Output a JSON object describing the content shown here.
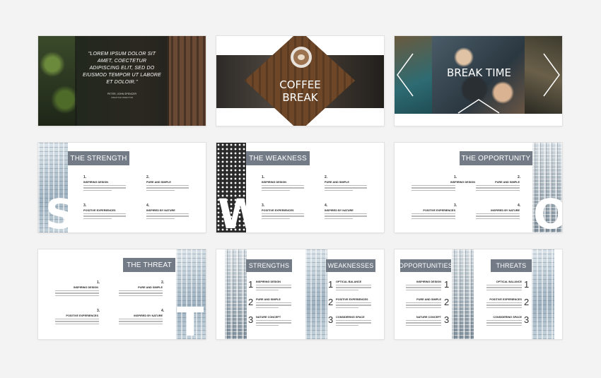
{
  "slide1": {
    "quote": "\"LOREM IPSUM DOLOR SIT AMET, COECTETUR ADIPISCING ELIT, SED DO EIUSMOD TEMPOR UT LABORE ET DOLOIR.\"",
    "author": "PETER, JOHN SPENCER",
    "role": "CREATIVE DIRECTOR"
  },
  "slide2": {
    "title_line1": "COFFEE",
    "title_line2": "BREAK"
  },
  "slide3": {
    "title": "BREAK TIME"
  },
  "slide4": {
    "title": "THE STRENGTH",
    "letter": "S",
    "items": [
      {
        "num": "1.",
        "heading": "INSPIRING DESIGN"
      },
      {
        "num": "2.",
        "heading": "PURE AND SIMPLE"
      },
      {
        "num": "3.",
        "heading": "POSITIVE EXPERIENCES"
      },
      {
        "num": "4.",
        "heading": "INSPIRED BY NATURE"
      }
    ]
  },
  "slide5": {
    "title": "THE WEAKNESS",
    "letter": "W",
    "items": [
      {
        "num": "1.",
        "heading": "INSPIRING DESIGN"
      },
      {
        "num": "2.",
        "heading": "PURE AND SIMPLE"
      },
      {
        "num": "3.",
        "heading": "POSITIVE EXPERIENCES"
      },
      {
        "num": "4.",
        "heading": "INSPIRED BY NATURE"
      }
    ]
  },
  "slide6": {
    "title": "THE OPPORTUNITY",
    "letter": "O",
    "items": [
      {
        "num": "1.",
        "heading": "INSPIRING DESIGN"
      },
      {
        "num": "2.",
        "heading": "PURE AND SIMPLE"
      },
      {
        "num": "3.",
        "heading": "POSITIVE EXPERIENCES"
      },
      {
        "num": "4.",
        "heading": "INSPIRED BY NATURE"
      }
    ]
  },
  "slide7": {
    "title": "THE THREAT",
    "letter": "T",
    "items": [
      {
        "num": "1.",
        "heading": "INSPIRING DESIGN"
      },
      {
        "num": "2.",
        "heading": "PURE AND SIMPLE"
      },
      {
        "num": "3.",
        "heading": "POSITIVE EXPERIENCES"
      },
      {
        "num": "4.",
        "heading": "INSPIRED BY NATURE"
      }
    ]
  },
  "slide8": {
    "left_title": "STRENGTHS",
    "right_title": "WEAKNESSES",
    "left_items": [
      {
        "num": "1",
        "heading": "INSPIRING DESIGN"
      },
      {
        "num": "2",
        "heading": "PURE AND SIMPLE"
      },
      {
        "num": "3",
        "heading": "NATURE CONCEPT"
      }
    ],
    "right_items": [
      {
        "num": "1",
        "heading": "OPTICAL BALANCE"
      },
      {
        "num": "2",
        "heading": "POSITIVE EXPERIENCES"
      },
      {
        "num": "3",
        "heading": "CONSIDERING SPACE"
      }
    ]
  },
  "slide9": {
    "left_title": "OPPORTUNITIES",
    "right_title": "THREATS",
    "left_items": [
      {
        "num": "1",
        "heading": "INSPIRING DESIGN"
      },
      {
        "num": "2",
        "heading": "PURE AND SIMPLE"
      },
      {
        "num": "3",
        "heading": "NATURE CONCEPT"
      }
    ],
    "right_items": [
      {
        "num": "1",
        "heading": "OPTICAL BALANCE"
      },
      {
        "num": "2",
        "heading": "POSITIVE EXPERIENCES"
      },
      {
        "num": "3",
        "heading": "CONSIDERING SPACE"
      }
    ]
  },
  "colors": {
    "accent": "#737b87",
    "background": "#f3f3f3"
  }
}
